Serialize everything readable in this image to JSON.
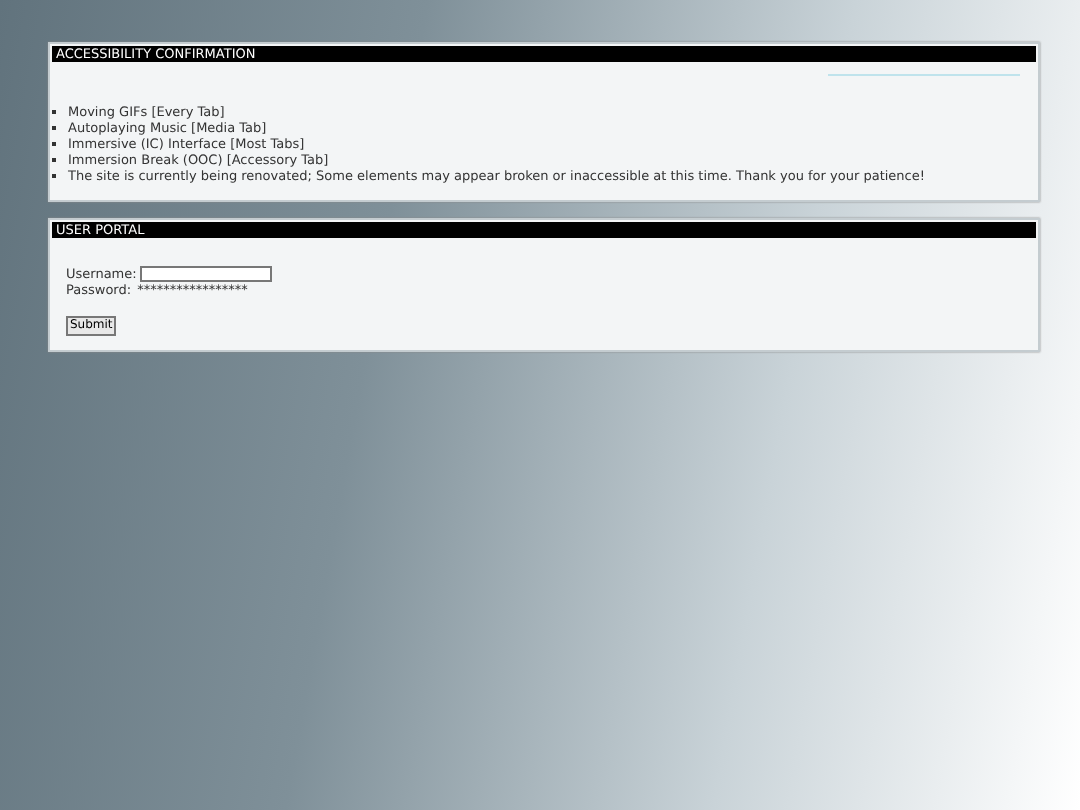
{
  "accessibility_panel": {
    "title": "ACCESSIBILITY CONFIRMATION",
    "items": [
      "Moving GIFs [Every Tab]",
      "Autoplaying Music [Media Tab]",
      "Immersive (IC) Interface [Most Tabs]",
      "Immersion Break (OOC) [Accessory Tab]",
      "The site is currently being renovated; Some elements may appear broken or inaccessible at this time. Thank you for your patience!"
    ]
  },
  "user_portal": {
    "title": "USER PORTAL",
    "username_label": "Username:",
    "password_label": "Password:",
    "password_value": "*****************",
    "submit": "Submit"
  }
}
